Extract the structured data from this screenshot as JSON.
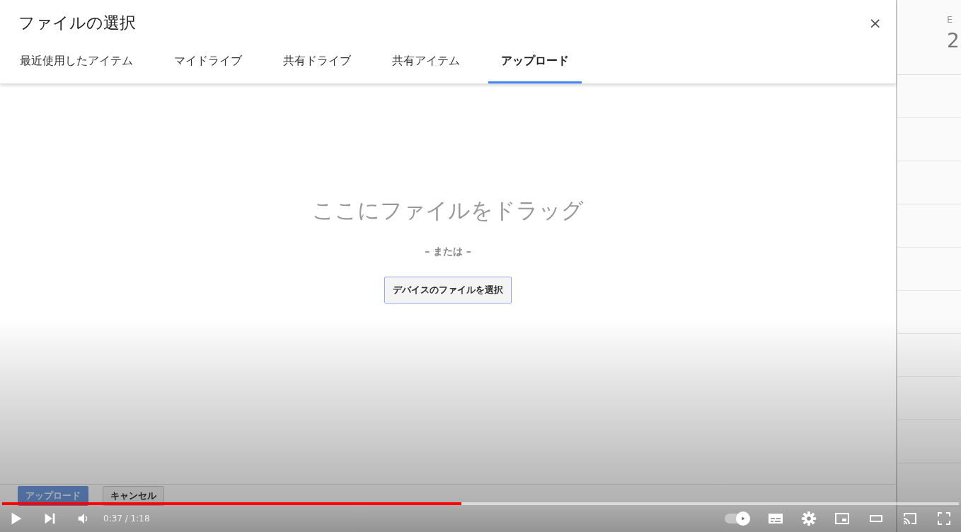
{
  "dialog": {
    "title": "ファイルの選択",
    "close": "×",
    "tabs": [
      {
        "label": "最近使用したアイテム",
        "selected": false
      },
      {
        "label": "マイドライブ",
        "selected": false
      },
      {
        "label": "共有ドライブ",
        "selected": false
      },
      {
        "label": "共有アイテム",
        "selected": false
      },
      {
        "label": "アップロード",
        "selected": true
      }
    ],
    "drop_text": "ここにファイルをドラッグ",
    "or_text": "– または –",
    "device_button": "デバイスのファイルを選択",
    "buttons": [
      {
        "label": "アップロード",
        "disabled": true
      },
      {
        "label": "キャンセル",
        "disabled": false
      }
    ]
  },
  "background": {
    "label": "E",
    "value": "2"
  },
  "player": {
    "progress": {
      "level": 0.48
    },
    "time": "0:37 / 1:18",
    "autoplay": {
      "on": true
    }
  }
}
